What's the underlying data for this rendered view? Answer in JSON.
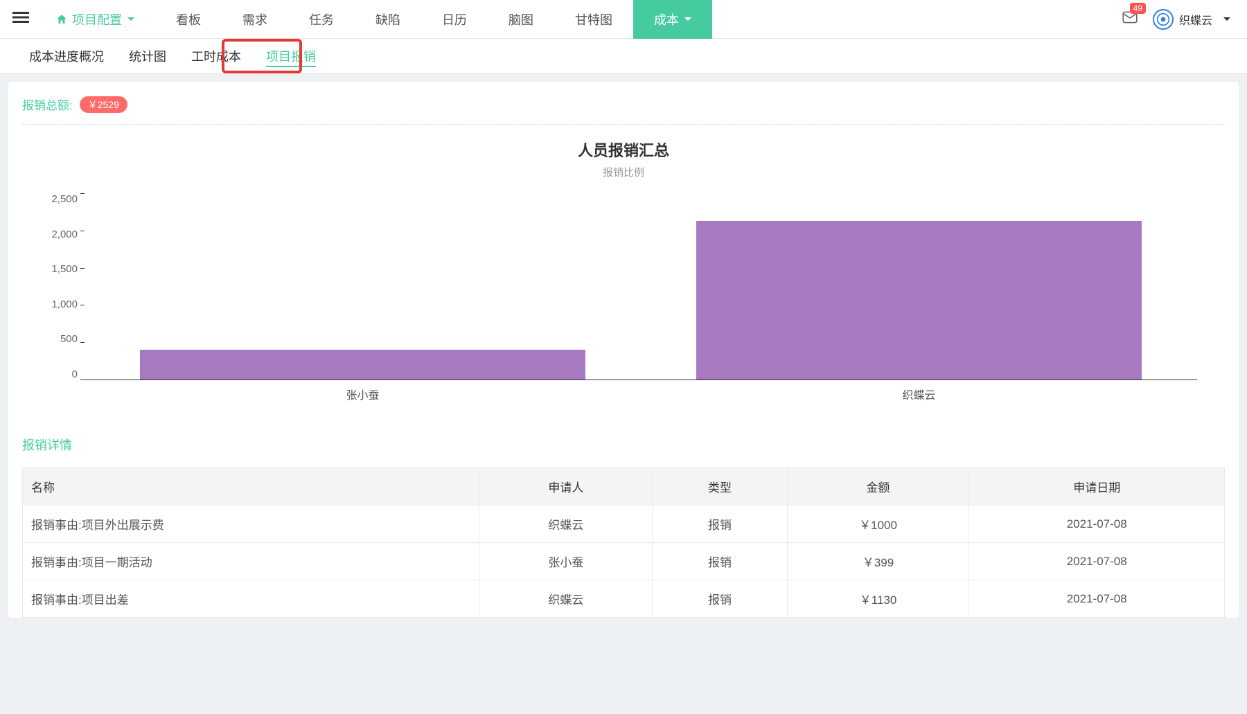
{
  "topnav": {
    "project_config": "项目配置",
    "items": [
      "看板",
      "需求",
      "任务",
      "缺陷",
      "日历",
      "脑图",
      "甘特图",
      "成本"
    ],
    "active_index": 7
  },
  "notif_count": "49",
  "user_name": "织蝶云",
  "subnav": {
    "items": [
      "成本进度概况",
      "统计图",
      "工时成本",
      "项目报销"
    ],
    "active_index": 3
  },
  "total": {
    "label": "报销总额:",
    "value": "￥2529"
  },
  "chart_data": {
    "type": "bar",
    "title": "人员报销汇总",
    "subtitle": "报销比例",
    "categories": [
      "张小蚕",
      "织蝶云"
    ],
    "values": [
      399,
      2130
    ],
    "ylim": [
      0,
      2500
    ],
    "y_ticks": [
      "2,500",
      "2,000",
      "1,500",
      "1,000",
      "500",
      "0"
    ]
  },
  "details_title": "报销详情",
  "table": {
    "headers": [
      "名称",
      "申请人",
      "类型",
      "金额",
      "申请日期"
    ],
    "rows": [
      [
        "报销事由:项目外出展示费",
        "织蝶云",
        "报销",
        "￥1000",
        "2021-07-08"
      ],
      [
        "报销事由:项目一期活动",
        "张小蚕",
        "报销",
        "￥399",
        "2021-07-08"
      ],
      [
        "报销事由:项目出差",
        "织蝶云",
        "报销",
        "￥1130",
        "2021-07-08"
      ]
    ]
  },
  "colors": {
    "accent": "#46cba0",
    "bar": "#a779c1",
    "badge": "#ff6b6b"
  }
}
